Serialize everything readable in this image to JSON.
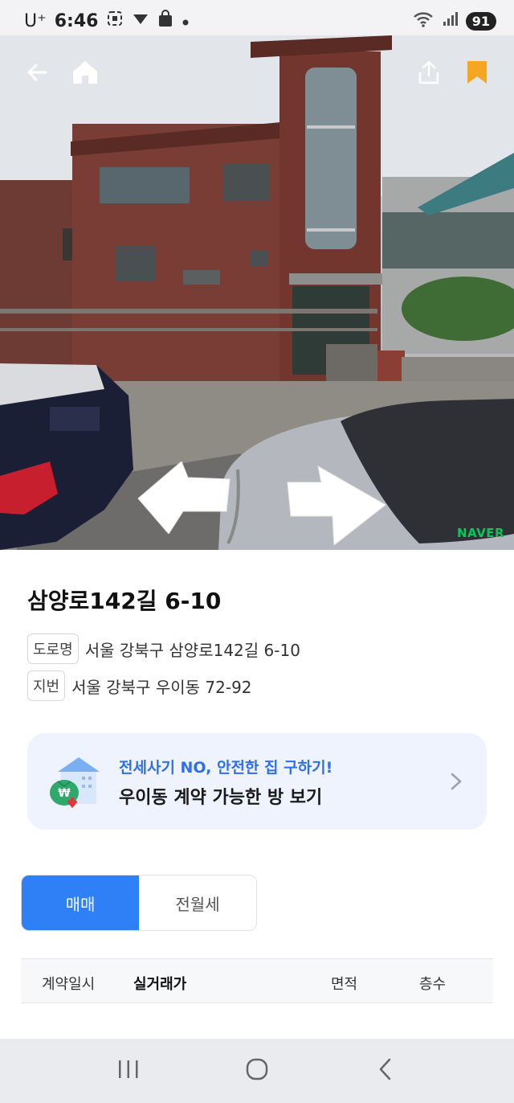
{
  "status_bar": {
    "carrier": "U⁺",
    "time": "6:46",
    "battery": "91"
  },
  "photo": {
    "watermark": "NAVER",
    "icons": {
      "back": "back-arrow-icon",
      "home": "home-icon",
      "share": "share-icon",
      "bookmark": "bookmark-icon",
      "prev": "prev-view-arrow-icon",
      "next": "next-view-arrow-icon"
    },
    "bookmark_color": "#f5a623"
  },
  "address": {
    "title": "삼양로142길 6-10",
    "road_tag": "도로명",
    "road_text": "서울 강북구 삼양로142길 6-10",
    "lot_tag": "지번",
    "lot_text": "서울 강북구 우이동 72-92"
  },
  "promo": {
    "line1": "전세사기 NO, 안전한 집 구하기!",
    "line2": "우이동 계약 가능한 방 보기",
    "accent": "#2f6fe8"
  },
  "tabs": [
    {
      "label": "매매",
      "active": true
    },
    {
      "label": "전월세",
      "active": false
    }
  ],
  "table": {
    "headers": [
      "계약일시",
      "실거래가",
      "면적",
      "층수"
    ]
  },
  "accent_color": "#2f80f6"
}
